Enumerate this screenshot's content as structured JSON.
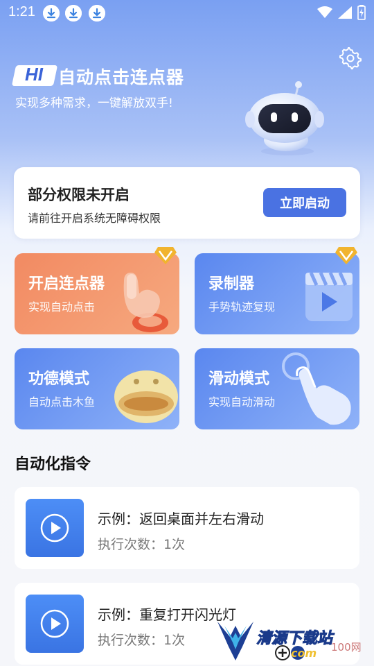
{
  "status_bar": {
    "time": "1:21",
    "icons": [
      "download-icon",
      "download-icon",
      "download-icon",
      "wifi-icon",
      "signal-icon",
      "battery-charging-icon"
    ]
  },
  "header": {
    "badge": "HI",
    "title": "自动点击连点器",
    "subtitle": "实现多种需求，一键解放双手!",
    "settings_icon": "gear-icon"
  },
  "permission_card": {
    "title": "部分权限未开启",
    "description": "请前往开启系统无障碍权限",
    "button_label": "立即启动"
  },
  "features": [
    {
      "title": "开启连点器",
      "description": "实现自动点击",
      "vip": true,
      "icon": "tap-hand-icon",
      "color": "#f28a62"
    },
    {
      "title": "录制器",
      "description": "手势轨迹复现",
      "vip": true,
      "icon": "video-play-icon",
      "color": "#5a87ef"
    },
    {
      "title": "功德模式",
      "description": "自动点击木鱼",
      "vip": false,
      "icon": "wooden-fish-icon",
      "color": "#5a87ef"
    },
    {
      "title": "滑动模式",
      "description": "实现自动滑动",
      "vip": false,
      "icon": "swipe-hand-icon",
      "color": "#5a87ef"
    }
  ],
  "automation": {
    "section_title": "自动化指令",
    "items": [
      {
        "name": "示例：返回桌面并左右滑动",
        "count": "执行次数：1次"
      },
      {
        "name": "示例：重复打开闪光灯",
        "count": "执行次数：1次"
      }
    ]
  },
  "watermark": {
    "text": "清源下载站",
    "url": "com",
    "site": "100网"
  }
}
